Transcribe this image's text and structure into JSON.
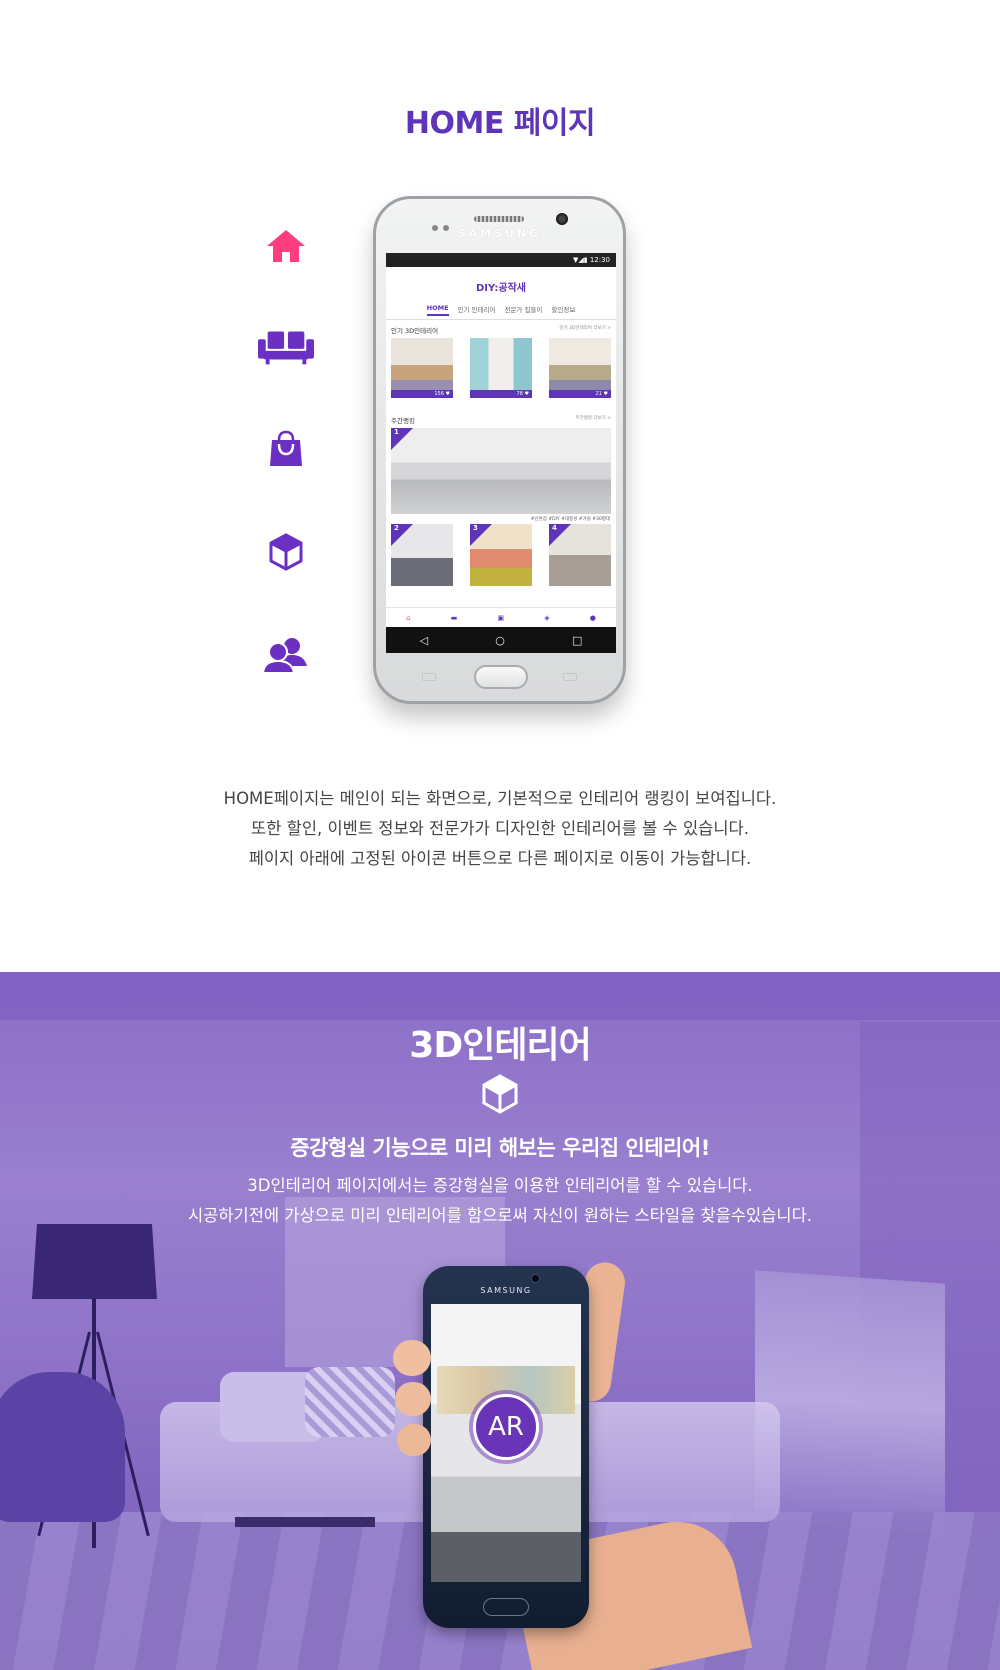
{
  "home": {
    "title": "HOME 페이지",
    "side_icons": [
      "home-icon",
      "sofa-icon",
      "shopping-bag-icon",
      "cube-icon",
      "users-icon"
    ],
    "colors": {
      "accent": "#5e34b8",
      "home_icon": "#ff3d7f",
      "icon_purple": "#6b2fc4"
    },
    "phone": {
      "brand": "SAMSUNG",
      "status_time": "12:30",
      "app_title": "DIY:공작새",
      "tabs": [
        "HOME",
        "인기 인테리어",
        "전문가 집들이",
        "할인정보"
      ],
      "section_popular": {
        "title": "인기 3D인테리어",
        "more": "인기 3D인테리어 더보기 >",
        "counts": [
          "156",
          "78",
          "21"
        ]
      },
      "section_weekly": {
        "title": "주간랭킹",
        "more": "주간랭킹 더보기 >",
        "ranks": [
          "1",
          "2",
          "3",
          "4"
        ]
      },
      "hashtags": "#신혼집 #DIY #대중성 #거실 #30평대",
      "bottom_nav": [
        "홈",
        "인테리어",
        "스토어",
        "3D인테리어",
        "커뮤니티"
      ]
    },
    "desc_lines": [
      "HOME페이지는 메인이 되는 화면으로, 기본적으로 인테리어 랭킹이 보여집니다.",
      "또한 할인, 이벤트 정보와 전문가가 디자인한 인테리어를 볼 수 있습니다.",
      "페이지 아래에 고정된 아이콘 버튼으로 다른 페이지로 이동이 가능합니다."
    ]
  },
  "interior3d": {
    "title": "3D인테리어",
    "icon": "cube-icon",
    "subtitle": "증강형실 기능으로 미리 해보는 우리집 인테리어!",
    "desc_lines": [
      "3D인테리어 페이지에서는 증강형실을 이용한 인테리어를 할 수 있습니다.",
      "시공하기전에 가상으로 미리 인테리어를 함으로써 자신이 원하는 스타일을 찾을수있습니다."
    ],
    "phone": {
      "brand": "SAMSUNG",
      "badge": "AR"
    }
  }
}
